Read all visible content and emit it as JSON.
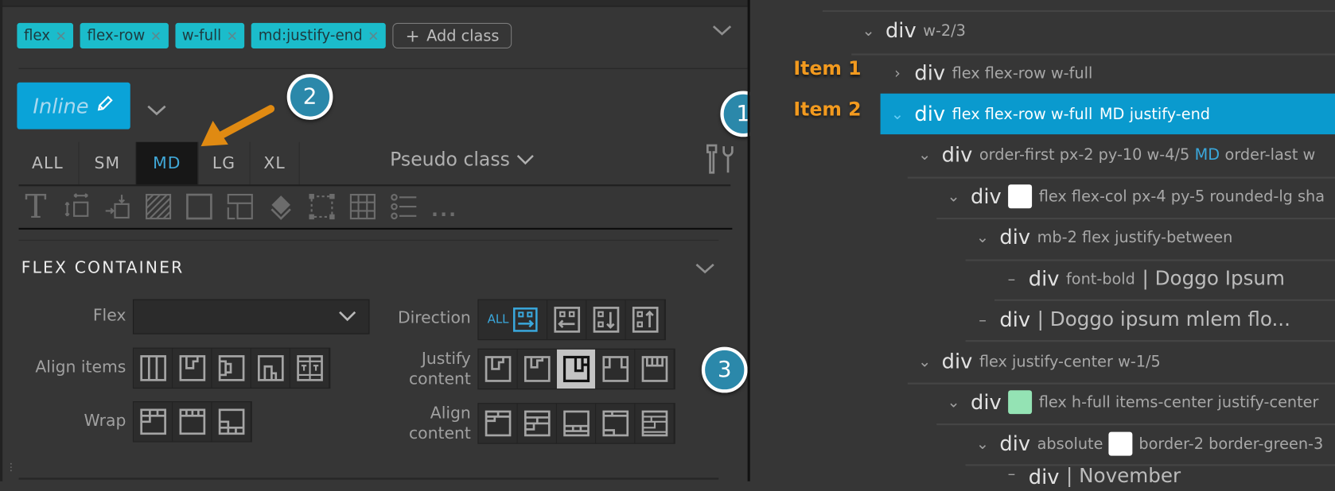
{
  "class_tags": [
    {
      "label": "flex"
    },
    {
      "label": "flex-row"
    },
    {
      "label": "w-full"
    },
    {
      "label": "md:justify-end"
    }
  ],
  "add_class_label": "Add class",
  "inline_button_label": "Inline",
  "breakpoints": [
    "ALL",
    "SM",
    "MD",
    "LG",
    "XL"
  ],
  "active_breakpoint": "MD",
  "pseudo_class_label": "Pseudo class",
  "more_tools_label": "...",
  "section_title": "FLEX CONTAINER",
  "fields": {
    "flex_label": "Flex",
    "flex_value": "",
    "direction_label": "Direction",
    "direction_all_label": "ALL",
    "align_items_label": "Align items",
    "justify_label_1": "Justify",
    "justify_label_2": "content",
    "wrap_label": "Wrap",
    "align_content_label_1": "Align",
    "align_content_label_2": "content"
  },
  "annotations": {
    "badge_1": "1",
    "badge_2": "2",
    "badge_3": "3",
    "item_1": "Item 1",
    "item_2": "Item 2",
    "arrow_color": "#e08a12"
  },
  "tree": [
    {
      "tag": "div",
      "classes": "w-2/3"
    },
    {
      "tag": "div",
      "classes": "flex flex-row w-full"
    },
    {
      "tag": "div",
      "classes": "flex flex-row w-full",
      "md": "MD",
      "md_classes": "justify-end",
      "selected": true
    },
    {
      "tag": "div",
      "classes": "order-first px-2 py-10 w-4/5",
      "md": "MD",
      "md_classes": "order-last w"
    },
    {
      "tag": "div",
      "swatch": "#ffffff",
      "classes": "flex flex-col px-4 py-5 rounded-lg sha"
    },
    {
      "tag": "div",
      "classes": "mb-2 flex justify-between"
    },
    {
      "tag": "div",
      "classes": "font-bold",
      "text": "| Doggo Ipsum"
    },
    {
      "tag": "div",
      "classes": "",
      "text": "| Doggo ipsum mlem flo..."
    },
    {
      "tag": "div",
      "classes": "flex justify-center w-1/5"
    },
    {
      "tag": "div",
      "swatch": "#94e3b4",
      "classes": "flex h-full items-center justify-center"
    },
    {
      "tag": "div",
      "classes": "absolute",
      "swatch": "#ffffff",
      "classes_after": "border-2 border-green-3"
    },
    {
      "tag": "div",
      "text": "| November"
    }
  ],
  "colors": {
    "accent": "#0a9ace",
    "tag_bg": "#1bbccb",
    "md_label": "#3aa8dc",
    "annotation": "#f29a1f"
  }
}
